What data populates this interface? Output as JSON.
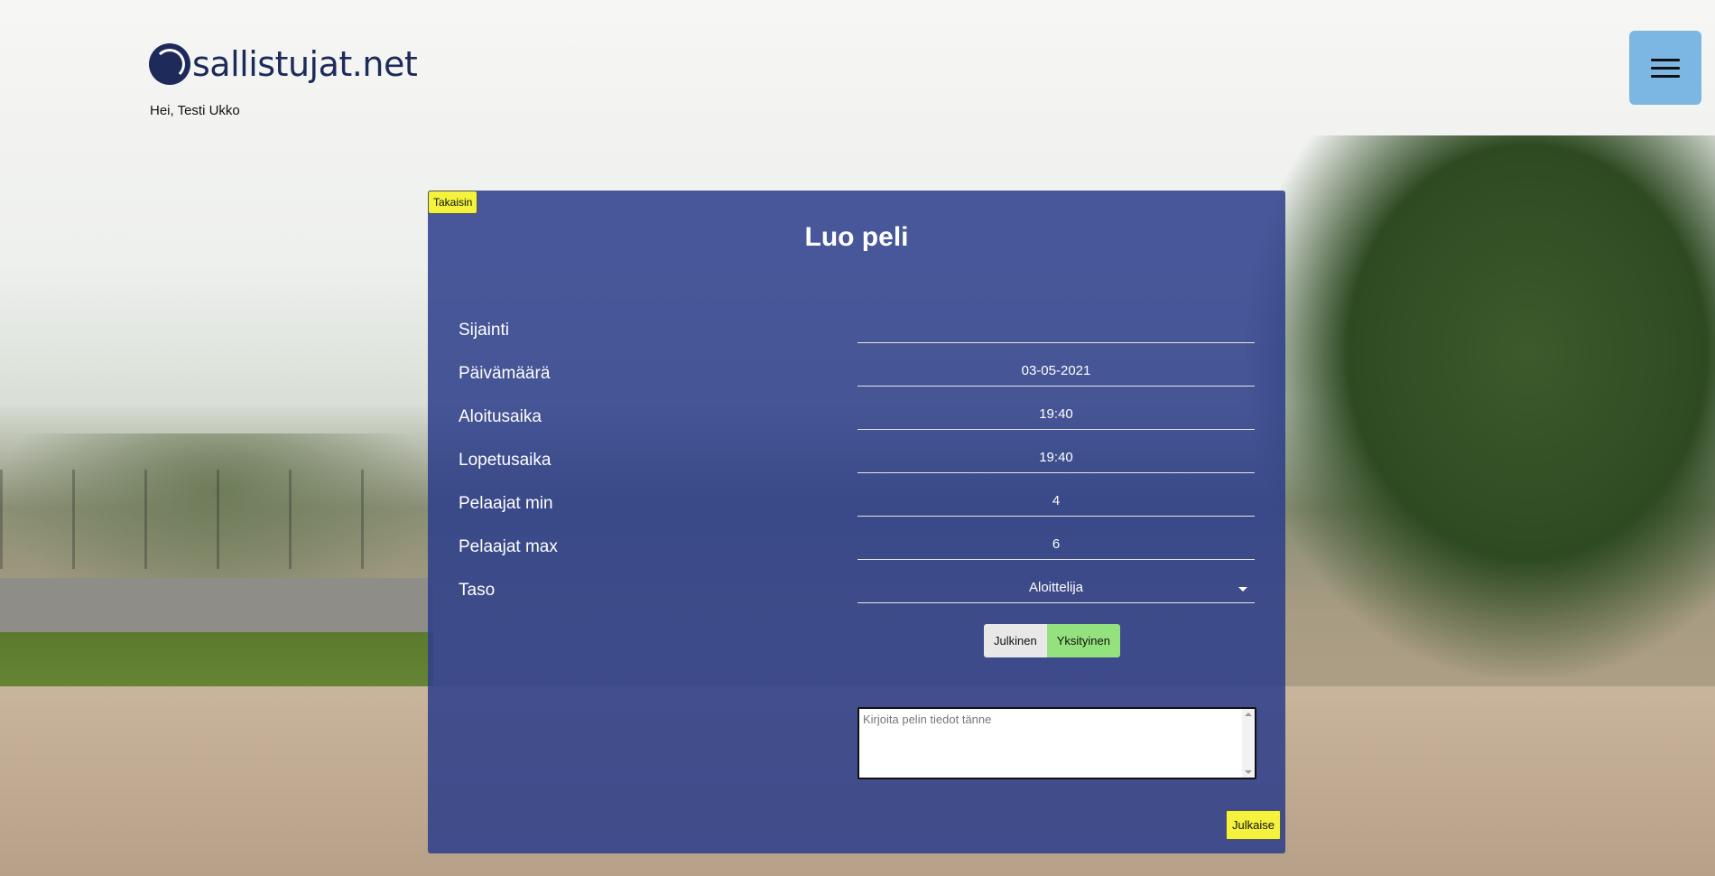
{
  "header": {
    "logo_text": "sallistujat.net",
    "greeting": "Hei, Testi Ukko"
  },
  "menu": {
    "icon": "hamburger-menu-icon"
  },
  "form": {
    "back_label": "Takaisin",
    "title": "Luo peli",
    "fields": [
      {
        "label": "Sijainti",
        "value": ""
      },
      {
        "label": "Päivämäärä",
        "value": "03-05-2021"
      },
      {
        "label": "Aloitusaika",
        "value": "19:40"
      },
      {
        "label": "Lopetusaika",
        "value": "19:40"
      },
      {
        "label": "Pelaajat min",
        "value": "4"
      },
      {
        "label": "Pelaajat max",
        "value": "6"
      },
      {
        "label": "Taso",
        "value": "Aloittelija"
      }
    ],
    "visibility": {
      "public_label": "Julkinen",
      "private_label": "Yksityinen",
      "selected": "Yksityinen"
    },
    "notes_placeholder": "Kirjoita pelin tiedot tänne",
    "publish_label": "Julkaise"
  },
  "colors": {
    "panel": "#2c3e8a",
    "accent_yellow": "#f4f23c",
    "toggle_selected": "#94e27e",
    "menu_button": "#7cb7e4",
    "logo": "#1e2b5a"
  }
}
